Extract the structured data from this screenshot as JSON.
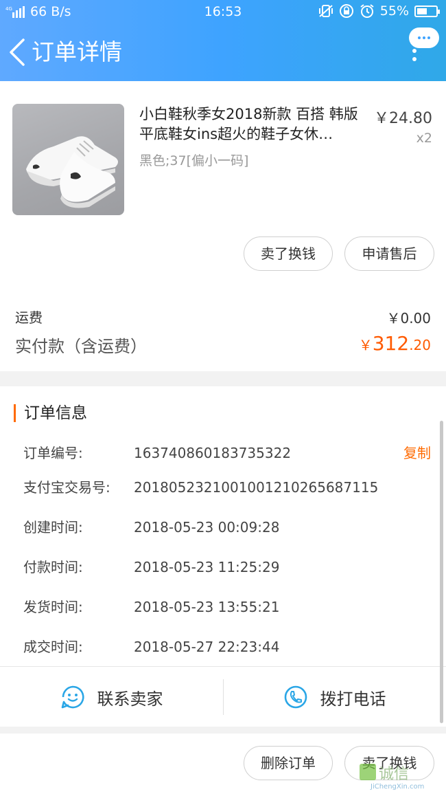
{
  "status_bar": {
    "network": "4G",
    "speed": "66 B/s",
    "time": "16:53",
    "battery": "55%",
    "battery_level": 0.55
  },
  "nav": {
    "title": "订单详情",
    "back_icon": "chevron-left-icon",
    "more_icon": "more-dots-icon"
  },
  "product": {
    "title": "小白鞋秋季女2018新款 百搭 韩版平底鞋女ins超火的鞋子女休…",
    "spec": "黑色;37[偏小一码]",
    "price": "￥24.80",
    "qty": "x2",
    "sell_button": "卖了换钱",
    "after_sale_button": "申请售后"
  },
  "fees": {
    "shipping_label": "运费",
    "shipping_value": "￥0.00",
    "total_label": "实付款（含运费）",
    "total_currency": "￥",
    "total_integer": "312",
    "total_decimal": ".20"
  },
  "order_info": {
    "section_title": "订单信息",
    "copy_label": "复制",
    "rows": [
      {
        "label": "订单编号:",
        "value": "163740860183735322"
      },
      {
        "label": "支付宝交易号:",
        "value": "2018052321001001210265687115"
      },
      {
        "label": "创建时间:",
        "value": "2018-05-23 00:09:28"
      },
      {
        "label": "付款时间:",
        "value": "2018-05-23 11:25:29"
      },
      {
        "label": "发货时间:",
        "value": "2018-05-23 13:55:21"
      },
      {
        "label": "成交时间:",
        "value": "2018-05-27 22:23:44"
      }
    ]
  },
  "contact": {
    "seller_label": "联系卖家",
    "phone_label": "拨打电话"
  },
  "footer": {
    "delete_button": "删除订单",
    "sell_button": "卖了换钱"
  },
  "watermark": "JiChengXin.com",
  "colors": {
    "accent": "#ff6a00",
    "header": "#3ea3ff",
    "icon_blue": "#2aa6e6"
  }
}
